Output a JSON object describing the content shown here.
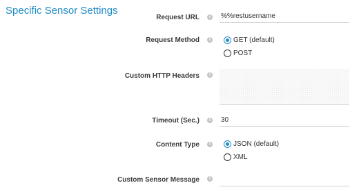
{
  "section": {
    "title": "Specific Sensor Settings"
  },
  "info_glyph": "i",
  "fields": {
    "request_url": {
      "label": "Request URL",
      "value": "%%restusername"
    },
    "request_method": {
      "label": "Request Method",
      "options": [
        "GET (default)",
        "POST"
      ],
      "selected": "GET (default)"
    },
    "custom_headers": {
      "label": "Custom HTTP Headers",
      "value": ""
    },
    "timeout": {
      "label": "Timeout (Sec.)",
      "value": "30"
    },
    "content_type": {
      "label": "Content Type",
      "options": [
        "JSON (default)",
        "XML"
      ],
      "selected": "JSON (default)"
    },
    "custom_message": {
      "label": "Custom Sensor Message",
      "value": ""
    }
  },
  "colors": {
    "accent": "#1e8ac6",
    "label": "#3a3a3a",
    "border": "#cfcfcf"
  }
}
